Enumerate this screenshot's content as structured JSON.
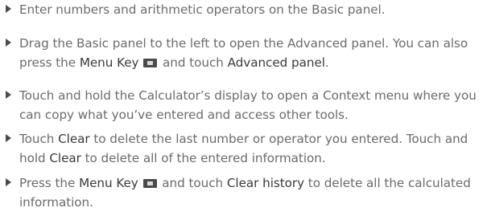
{
  "colors": {
    "body_text": "#6b6b6b",
    "keyword_text": "#3a3a3a",
    "bullet": "#4a4a4a"
  },
  "bullet_icon": "triangle-right-icon",
  "menu_key_icon": "menu-key-icon",
  "items": [
    {
      "t1": "Enter numbers and arithmetic operators on the Basic panel."
    },
    {
      "t1": "Drag the Basic panel to the left to open the Advanced panel. You can also press the ",
      "k1": "Menu Key",
      "t2": " and touch ",
      "k2": "Advanced panel",
      "t3": "."
    },
    {
      "t1": "Touch and hold the Calculator’s display to open a Context menu where you can copy what you’ve entered and access other tools."
    },
    {
      "t1": "Touch ",
      "k1": "Clear",
      "t2": " to delete the last number or operator you entered. Touch and hold ",
      "k2": "Clear",
      "t3": " to delete all of the entered information."
    },
    {
      "t1": "Press the ",
      "k1": "Menu Key",
      "t2": " and touch ",
      "k2": "Clear history",
      "t3": " to delete all the calculated information."
    }
  ]
}
